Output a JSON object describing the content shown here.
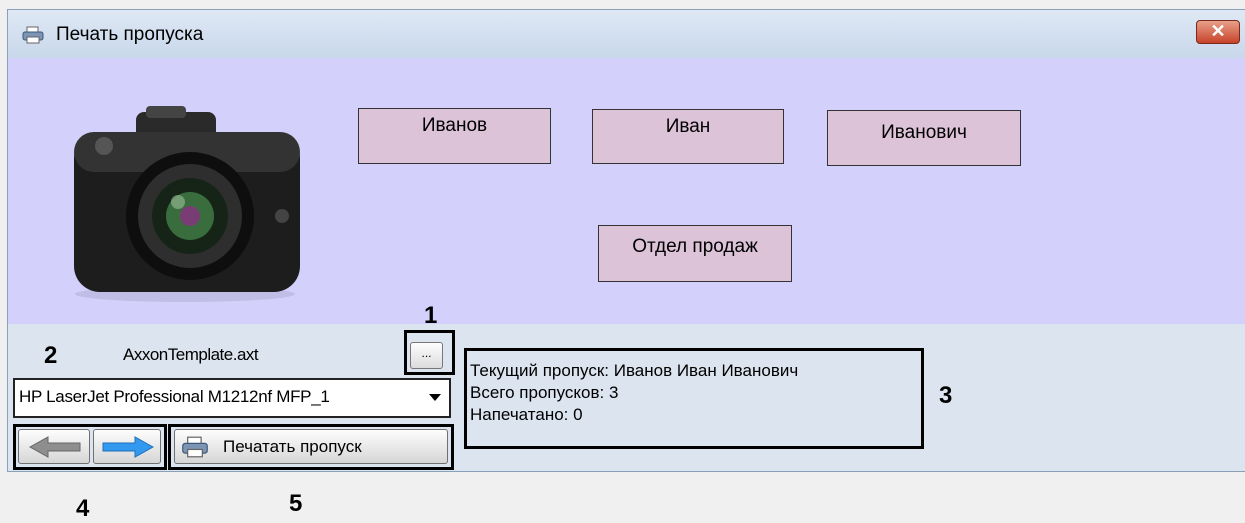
{
  "window": {
    "title": "Печать пропуска",
    "close_glyph": "✕",
    "close_icon": "close-icon"
  },
  "card": {
    "photo_icon": "camera-icon",
    "last_name": "Иванов",
    "first_name": "Иван",
    "middle_name": "Иванович",
    "department": "Отдел продаж"
  },
  "controls": {
    "template_file": "AxxonTemplate.axt",
    "browse_label": "...",
    "printer": "HP LaserJet Professional M1212nf MFP_1",
    "print_label": "Печатать пропуск"
  },
  "status": {
    "current": "Текущий пропуск: Иванов Иван Иванович",
    "total": "Всего пропусков: 3",
    "printed": "Напечатано: 0"
  },
  "markers": {
    "m1": "1",
    "m2": "2",
    "m3": "3",
    "m4": "4",
    "m5": "5"
  },
  "colors": {
    "card_background": "#d3d1fb",
    "field_background": "#dcc3d8",
    "arrow_blue": "#3399ee"
  }
}
